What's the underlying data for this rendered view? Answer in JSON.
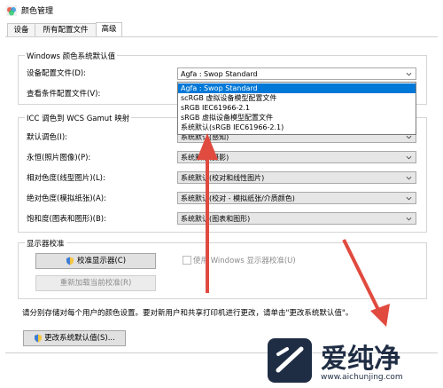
{
  "window": {
    "title": "颜色管理"
  },
  "tabs": [
    {
      "label": "设备"
    },
    {
      "label": "所有配置文件"
    },
    {
      "label": "高级"
    }
  ],
  "windows_defaults": {
    "group_title": "Windows 颜色系统默认值",
    "device_profile_label": "设备配置文件(D):",
    "device_profile_value": "Agfa : Swop Standard",
    "viewing_conditions_label": "查看条件配置文件(V):"
  },
  "dropdown_options": [
    "Agfa : Swop Standard",
    "scRGB 虚拟设备模型配置文件",
    "sRGB IEC61966-2.1",
    "sRGB 虚拟设备模型配置文件",
    "系统默认(sRGB IEC61966-2.1)"
  ],
  "icc_mapping": {
    "group_title": "ICC 调色到 WCS Gamut 映射",
    "rows": [
      {
        "label": "默认调色(I):",
        "value": "系统默认(感知)"
      },
      {
        "label": "永恒(照片图像)(P):",
        "value": "系统默认(摄影)"
      },
      {
        "label": "相对色度(线型图片)(L):",
        "value": "系统默认(校对和线性图片)"
      },
      {
        "label": "绝对色度(模拟纸张)(A):",
        "value": "系统默认(校对 - 模拟纸张/介质颜色)"
      },
      {
        "label": "饱和度(图表和图形)(B):",
        "value": "系统默认(图表和图形)"
      }
    ]
  },
  "calibration": {
    "group_title": "显示器校准",
    "calibrate_button": "校准显示器(C)",
    "reload_button": "重新加载当前校准(R)",
    "use_windows_calibration": "使用 Windows 显示器校准(U)"
  },
  "footer": {
    "note": "请分别存储对每个用户的颜色设置。要对新用户和共享打印机进行更改，请单击\"更改系统默认值\"。",
    "change_defaults_button": "更改系统默认值(S)..."
  },
  "watermark": {
    "brand": "爱纯净",
    "url": "www.aichunjing.com"
  },
  "colors": {
    "accent": "#0078d7",
    "arrow": "#d9534f"
  }
}
